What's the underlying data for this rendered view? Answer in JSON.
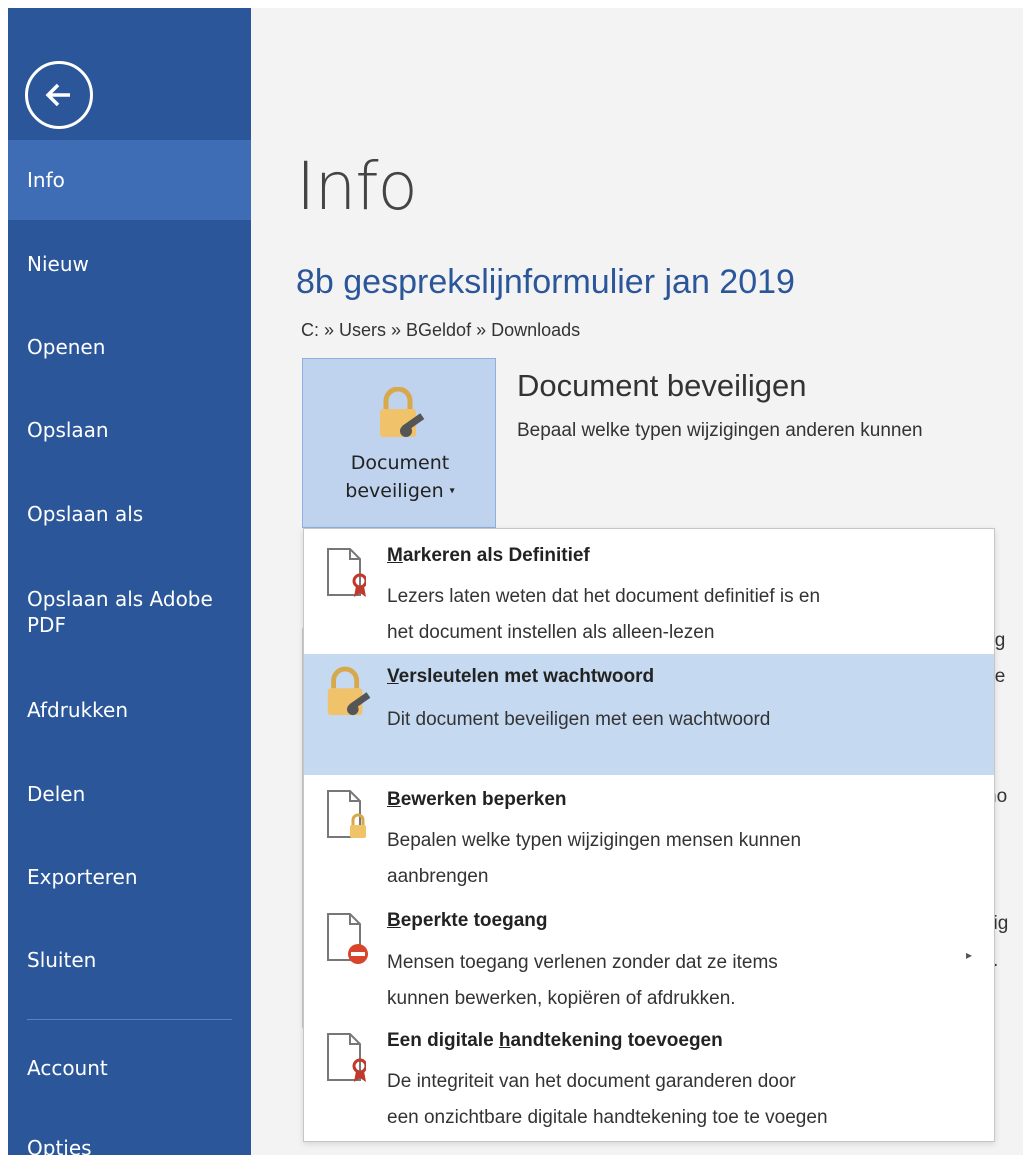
{
  "sidebar": {
    "items": [
      {
        "label": "Info",
        "active": true
      },
      {
        "label": "Nieuw"
      },
      {
        "label": "Openen"
      },
      {
        "label": "Opslaan"
      },
      {
        "label": "Opslaan als"
      },
      {
        "label": "Opslaan als Adobe PDF"
      },
      {
        "label": "Afdrukken"
      },
      {
        "label": "Delen"
      },
      {
        "label": "Exporteren"
      },
      {
        "label": "Sluiten"
      },
      {
        "label": "Account"
      },
      {
        "label": "Opties"
      }
    ],
    "back_icon": "arrow-left-circle-icon"
  },
  "main": {
    "page_title": "Info",
    "doc_title": "8b gesprekslijnformulier jan 2019",
    "doc_path": "C: » Users » BGeldof » Downloads",
    "protect_button": {
      "line1": "Document",
      "line2": "beveiligen"
    },
    "protect_heading": "Document beveiligen",
    "protect_description": "Bepaal welke typen wijzigingen anderen kunnen",
    "background_fragments": [
      "olg",
      "tse",
      "no",
      "zig",
      "."
    ]
  },
  "dropdown": {
    "items": [
      {
        "prefix": "",
        "underline": "M",
        "suffix": "arkeren als Definitief",
        "desc1": "Lezers laten weten dat het document definitief is en",
        "desc2": "het document instellen als alleen-lezen",
        "icon": "document-ribbon-icon"
      },
      {
        "prefix": "",
        "underline": "V",
        "suffix": "ersleutelen met wachtwoord",
        "desc1": "Dit document beveiligen met een wachtwoord",
        "desc2": "",
        "icon": "lock-key-icon",
        "highlighted": true
      },
      {
        "prefix": "",
        "underline": "B",
        "suffix": "ewerken beperken",
        "desc1": "Bepalen welke typen wijzigingen mensen kunnen",
        "desc2": "aanbrengen",
        "icon": "document-lock-icon"
      },
      {
        "prefix": "",
        "underline": "B",
        "suffix": "eperkte toegang",
        "desc1": "Mensen toegang verlenen zonder dat ze items",
        "desc2": "kunnen bewerken, kopiëren of afdrukken.",
        "icon": "document-restricted-icon",
        "has_submenu": true
      },
      {
        "prefix": "Een digitale ",
        "underline": "h",
        "suffix": "andtekening toevoegen",
        "desc1": "De integriteit van het document garanderen door",
        "desc2": "een onzichtbare digitale handtekening toe te voegen",
        "icon": "document-ribbon-icon"
      }
    ]
  },
  "colors": {
    "sidebar": "#2b579a",
    "sidebar_active": "#3e6db5",
    "highlight": "#c5d9f1",
    "title_blue": "#2b579a"
  }
}
